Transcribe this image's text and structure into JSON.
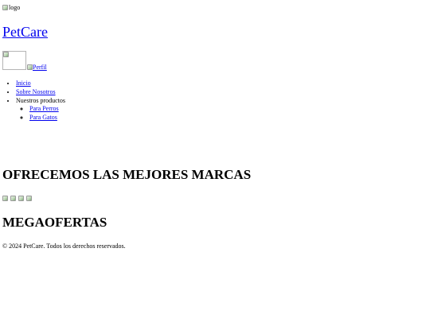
{
  "header": {
    "logo_alt": "logo",
    "site_title": "PetCare",
    "profile_alt": "Perfil"
  },
  "nav": {
    "items": [
      {
        "label": "Inicio"
      },
      {
        "label": "Sobre Nosotros"
      },
      {
        "label": "Nuestros productos"
      }
    ],
    "products_submenu": [
      {
        "label": "Para Perros"
      },
      {
        "label": "Para Gatos"
      }
    ]
  },
  "brands": {
    "title": "OFRECEMOS LAS MEJORES MARCAS",
    "image_count": 4
  },
  "offers": {
    "title": "MEGAOFERTAS"
  },
  "footer": {
    "text": "© 2024 PetCare. Todos los derechos reservados."
  },
  "icons": {
    "broken_image": "broken-image-icon"
  },
  "colors": {
    "link": "#0000ee",
    "text": "#000000",
    "background": "#ffffff"
  }
}
